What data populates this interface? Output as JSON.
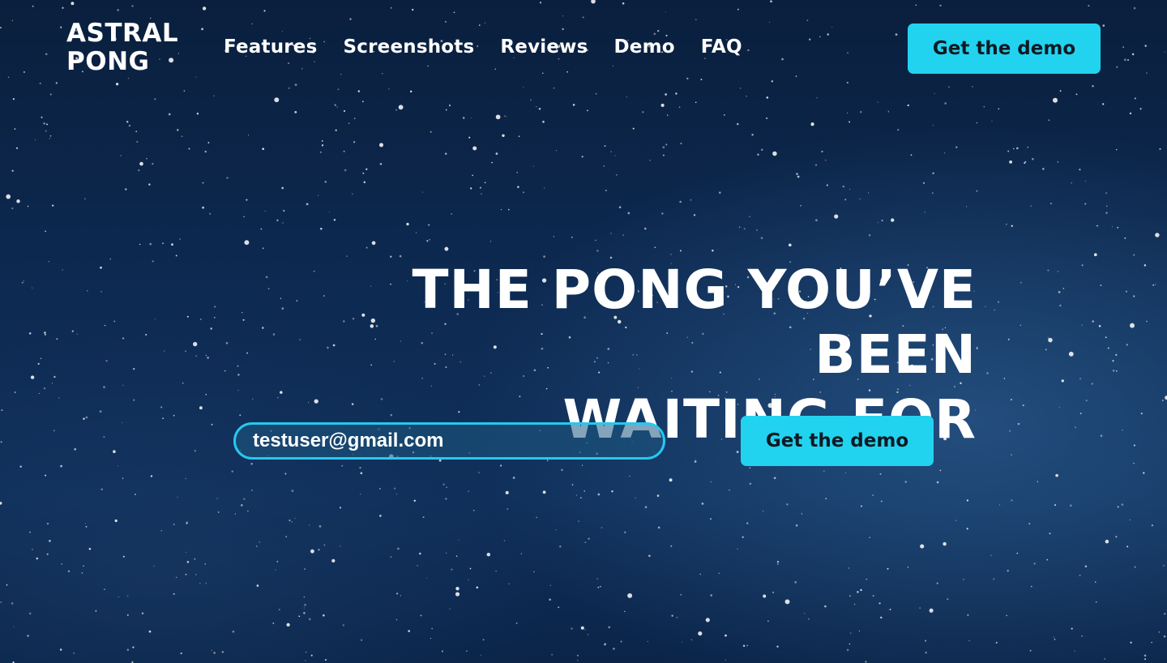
{
  "theme": {
    "accent": "#22d3f0",
    "input_border": "#27c8ee",
    "background": "#0d2a52"
  },
  "logo": {
    "line1": "ASTRAL",
    "line2": "PONG"
  },
  "nav": {
    "items": [
      {
        "label": "Features"
      },
      {
        "label": "Screenshots"
      },
      {
        "label": "Reviews"
      },
      {
        "label": "Demo"
      },
      {
        "label": "FAQ"
      }
    ]
  },
  "header": {
    "cta_label": "Get the demo"
  },
  "hero": {
    "headline_line1": "THE PONG YOU’VE BEEN",
    "headline_line2": "WAITING FOR",
    "email_value": "testuser@gmail.com",
    "cta_label": "Get the demo"
  }
}
